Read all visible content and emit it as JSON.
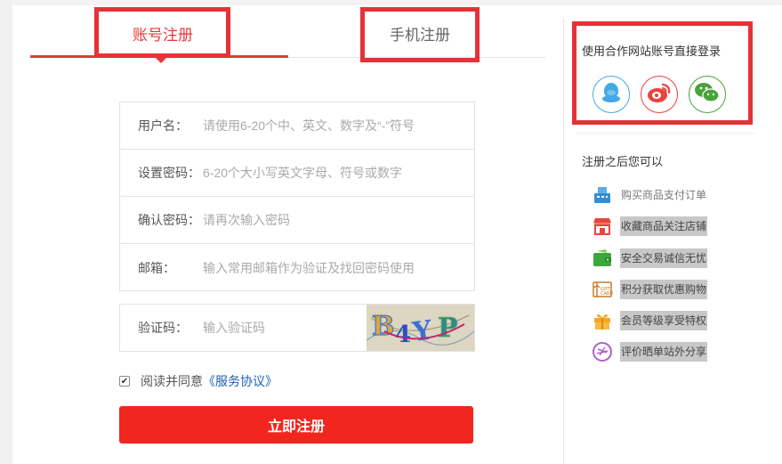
{
  "tabs": {
    "account_label": "账号注册",
    "phone_label": "手机注册"
  },
  "form": {
    "username": {
      "label": "用户名：",
      "placeholder": "请使用6-20个中、英文、数字及“-”符号"
    },
    "password": {
      "label": "设置密码：",
      "placeholder": "6-20个大小写英文字母、符号或数字"
    },
    "confirm": {
      "label": "确认密码：",
      "placeholder": "请再次输入密码"
    },
    "email": {
      "label": "邮箱：",
      "placeholder": "输入常用邮箱作为验证及找回密码使用"
    },
    "captcha": {
      "label": "验证码：",
      "placeholder": "输入验证码",
      "image_text": "B4YP"
    }
  },
  "agreement": {
    "text": "阅读并同意",
    "link": "《服务协议》",
    "checked": true
  },
  "submit_label": "立即注册",
  "social": {
    "title": "使用合作网站账号直接登录",
    "icons": [
      "qq-icon",
      "weibo-icon",
      "wechat-icon"
    ]
  },
  "benefits": {
    "title": "注册之后您可以",
    "items": [
      {
        "icon": "cash-register-icon",
        "text": "购买商品支付订单"
      },
      {
        "icon": "store-icon",
        "text": "收藏商品关注店铺"
      },
      {
        "icon": "wallet-icon",
        "text": "安全交易诚信无忧"
      },
      {
        "icon": "gift-card-icon",
        "text": "积分获取优惠购物"
      },
      {
        "icon": "gift-box-icon",
        "text": "会员等级享受特权"
      },
      {
        "icon": "share-icon",
        "text": "评价晒单站外分享"
      }
    ]
  },
  "colors": {
    "accent": "#e4393c",
    "button": "#f2261e",
    "link": "#1e5fb3",
    "annotation_box": "#e53238"
  }
}
